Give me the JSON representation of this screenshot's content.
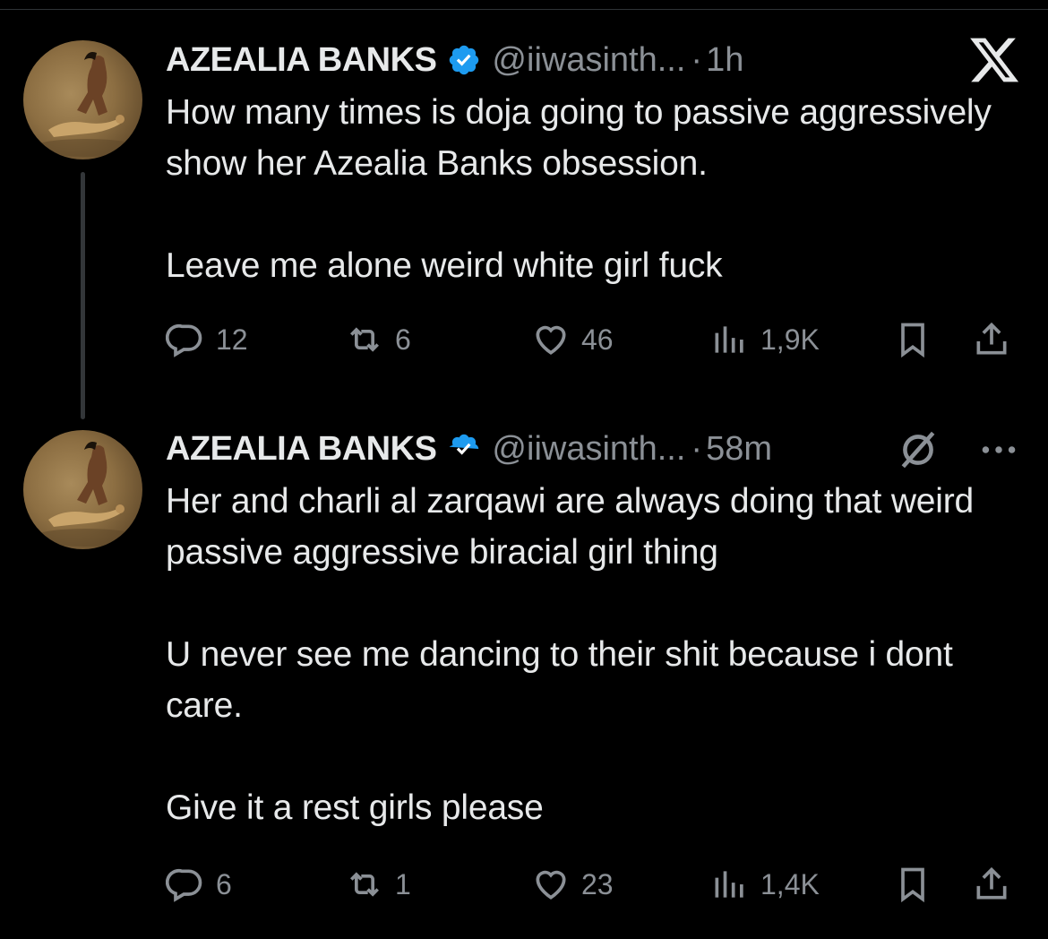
{
  "colors": {
    "background": "#000000",
    "text": "#e7e9ea",
    "secondary": "#8b9096",
    "verified": "#1d9bf0"
  },
  "tweets": [
    {
      "name": "AZEALIA BANKS",
      "handle": "@iiwasinth...",
      "dot": "·",
      "time": "1h",
      "text": "How many times is doja going to passive aggressively show her Azealia Banks obsession.\n\nLeave me alone weird white girl fuck",
      "replies": "12",
      "retweets": "6",
      "likes": "46",
      "views": "1,9K",
      "top_right_icon": "x-logo-icon"
    },
    {
      "name": "AZEALIA BANKS",
      "handle": "@iiwasinth...",
      "dot": "·",
      "time": "58m",
      "text": "Her and charli al zarqawi are always doing that weird passive aggressive biracial girl thing\n\nU never see me dancing to their shit because i dont care.\n\nGive it a rest girls please",
      "replies": "6",
      "retweets": "1",
      "likes": "23",
      "views": "1,4K",
      "top_right_icons": [
        "grok-icon",
        "more-icon"
      ]
    }
  ]
}
